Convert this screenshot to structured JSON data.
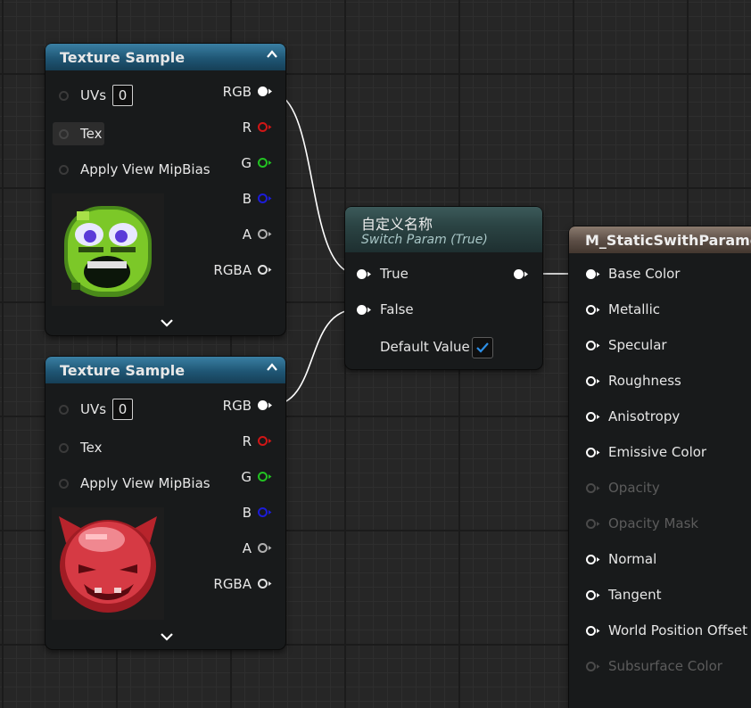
{
  "texture_nodes": [
    {
      "title": "Texture Sample",
      "uvs_label": "UVs",
      "uvs_value": "0",
      "tex_label": "Tex",
      "mipbias_label": "Apply View MipBias",
      "outputs": {
        "rgb": "RGB",
        "r": "R",
        "g": "G",
        "b": "B",
        "a": "A",
        "rgba": "RGBA"
      }
    },
    {
      "title": "Texture Sample",
      "uvs_label": "UVs",
      "uvs_value": "0",
      "tex_label": "Tex",
      "mipbias_label": "Apply View MipBias",
      "outputs": {
        "rgb": "RGB",
        "r": "R",
        "g": "G",
        "b": "B",
        "a": "A",
        "rgba": "RGBA"
      }
    }
  ],
  "switch_node": {
    "title": "自定义名称",
    "subtitle": "Switch Param (True)",
    "true_label": "True",
    "false_label": "False",
    "default_label": "Default Value",
    "default_checked": true
  },
  "material_node": {
    "title": "M_StaticSwithParameter",
    "inputs": [
      {
        "label": "Base Color",
        "enabled": true
      },
      {
        "label": "Metallic",
        "enabled": true
      },
      {
        "label": "Specular",
        "enabled": true
      },
      {
        "label": "Roughness",
        "enabled": true
      },
      {
        "label": "Anisotropy",
        "enabled": true
      },
      {
        "label": "Emissive Color",
        "enabled": true
      },
      {
        "label": "Opacity",
        "enabled": false
      },
      {
        "label": "Opacity Mask",
        "enabled": false
      },
      {
        "label": "Normal",
        "enabled": true
      },
      {
        "label": "Tangent",
        "enabled": true
      },
      {
        "label": "World Position Offset",
        "enabled": true
      },
      {
        "label": "Subsurface Color",
        "enabled": false
      }
    ]
  },
  "colors": {
    "header_texture": "#1f5674",
    "header_switch": "#2b4444",
    "header_material": "#5b4d45",
    "pin_r": "#d01616",
    "pin_g": "#22c222",
    "pin_b": "#1c1cd8",
    "pin_a": "#b0b0b0",
    "wire": "#ffffff",
    "checkbox_accent": "#2d8fe6"
  }
}
